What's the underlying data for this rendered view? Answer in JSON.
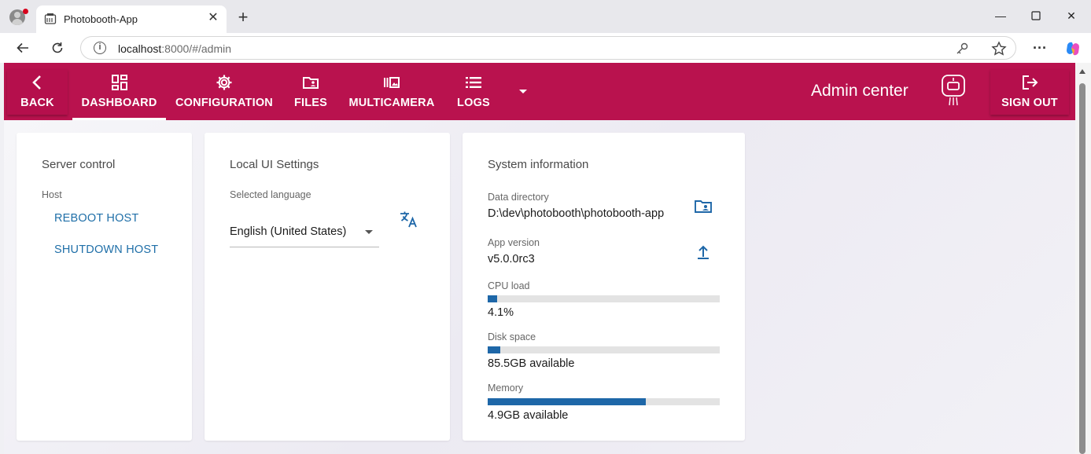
{
  "browser": {
    "tab_title": "Photobooth-App",
    "url_host": "localhost",
    "url_path": ":8000/#/admin",
    "icons": [
      "profile-icon",
      "favicon-icon",
      "close-icon",
      "plus-icon",
      "minimize-icon",
      "maximize-icon",
      "window-close-icon",
      "back-arrow-icon",
      "reload-icon",
      "info-icon",
      "key-icon",
      "star-icon",
      "more-icon",
      "copilot-icon"
    ]
  },
  "header": {
    "back_label": "BACK",
    "nav": [
      {
        "label": "DASHBOARD",
        "icon": "dashboard-icon"
      },
      {
        "label": "CONFIGURATION",
        "icon": "gear-icon"
      },
      {
        "label": "FILES",
        "icon": "folder-icon"
      },
      {
        "label": "MULTICAMERA",
        "icon": "multicamera-icon"
      },
      {
        "label": "LOGS",
        "icon": "list-icon"
      }
    ],
    "title": "Admin center",
    "signout_label": "SIGN OUT",
    "colors": {
      "primary": "#b9124e",
      "text": "#ffffff"
    }
  },
  "server_control": {
    "title": "Server control",
    "host_label": "Host",
    "reboot_label": "REBOOT HOST",
    "shutdown_label": "SHUTDOWN HOST"
  },
  "local_ui": {
    "title": "Local UI Settings",
    "language_label": "Selected language",
    "language_value": "English (United States)"
  },
  "system_info": {
    "title": "System information",
    "data_dir_label": "Data directory",
    "data_dir_value": "D:\\dev\\photobooth\\photobooth-app",
    "app_version_label": "App version",
    "app_version_value": "v5.0.0rc3",
    "cpu_label": "CPU load",
    "cpu_value": "4.1%",
    "cpu_fraction": 0.041,
    "disk_label": "Disk space",
    "disk_value": "85.5GB available",
    "disk_fraction": 0.055,
    "memory_label": "Memory",
    "memory_value": "4.9GB available",
    "memory_fraction": 0.68,
    "accent": "#1e67a8"
  }
}
